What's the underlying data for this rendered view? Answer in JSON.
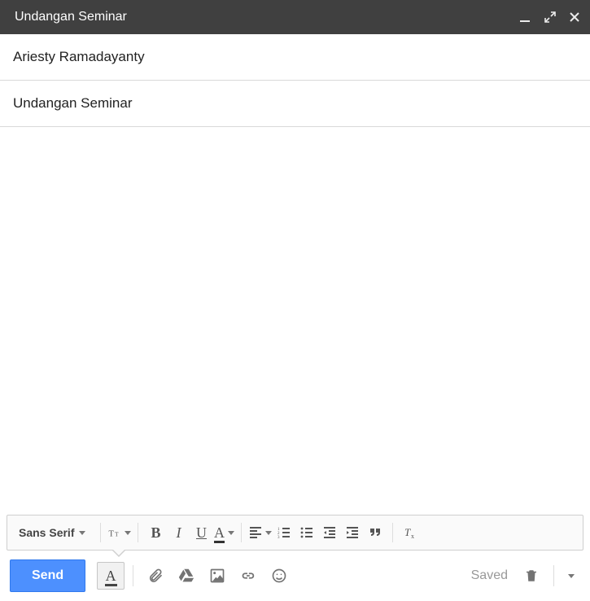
{
  "header": {
    "title": "Undangan Seminar"
  },
  "fields": {
    "to": "Ariesty Ramadayanty",
    "subject": "Undangan Seminar"
  },
  "format": {
    "font_name": "Sans Serif"
  },
  "actions": {
    "send_label": "Send",
    "saved_label": "Saved"
  }
}
